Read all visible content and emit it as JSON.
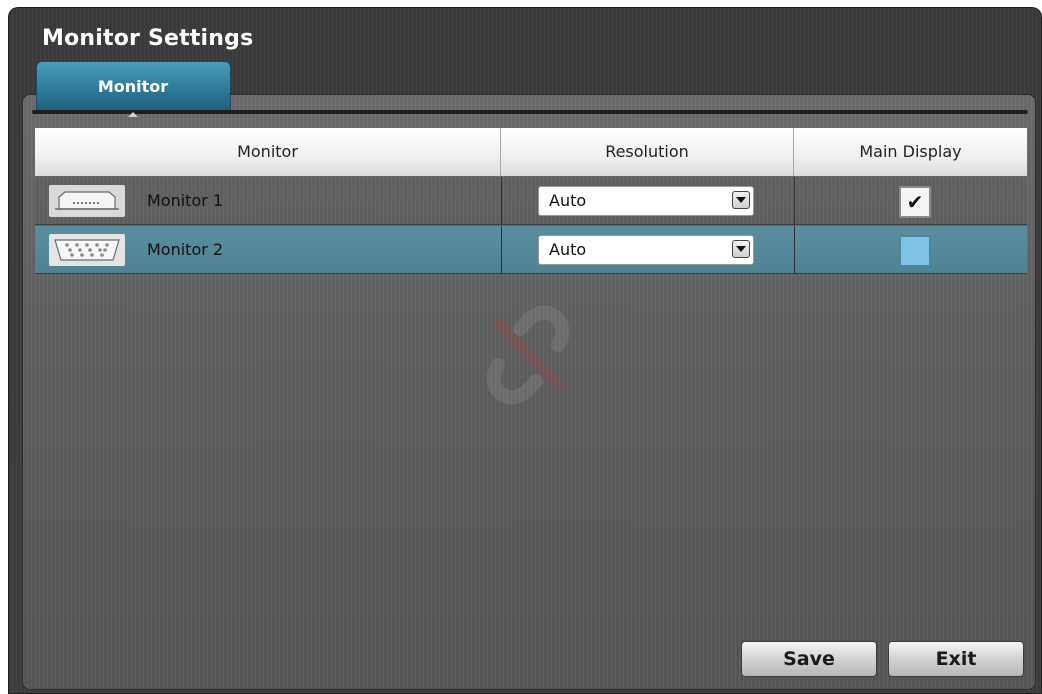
{
  "window": {
    "title": "Monitor Settings"
  },
  "tabs": [
    {
      "label": "Monitor",
      "active": true
    }
  ],
  "table": {
    "headers": [
      "Monitor",
      "Resolution",
      "Main Display"
    ],
    "rows": [
      {
        "icon": "dvi-connector-icon",
        "name": "Monitor 1",
        "resolution": "Auto",
        "main_display": true,
        "selected": false
      },
      {
        "icon": "vga-connector-icon",
        "name": "Monitor 2",
        "resolution": "Auto",
        "main_display": false,
        "selected": true
      }
    ]
  },
  "watermark": {
    "icon": "logo-watermark-icon"
  },
  "buttons": {
    "save": "Save",
    "exit": "Exit"
  },
  "colors": {
    "tab_accent": "#2f7a9b",
    "selected_row": "#5b8e9e",
    "checkbox_unchecked": "#7ec3e6"
  }
}
